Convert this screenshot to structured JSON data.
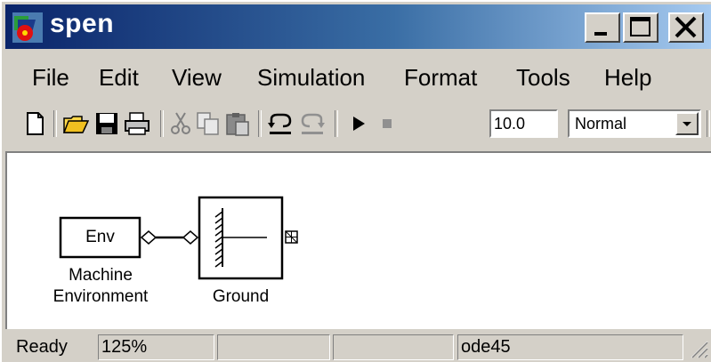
{
  "window": {
    "title": "spen",
    "controls": {
      "minimize": "minimize-icon",
      "maximize": "maximize-icon",
      "close": "close-icon"
    }
  },
  "menubar": {
    "items": [
      "File",
      "Edit",
      "View",
      "Simulation",
      "Format",
      "Tools",
      "Help"
    ]
  },
  "toolbar": {
    "icons": [
      "new-file-icon",
      "open-folder-icon",
      "save-icon",
      "print-icon",
      "cut-icon",
      "copy-icon",
      "paste-icon",
      "undo-icon",
      "redo-icon",
      "start-simulation-icon",
      "stop-simulation-icon"
    ],
    "stop_time": "10.0",
    "sim_mode": "Normal"
  },
  "canvas": {
    "blocks": [
      {
        "name": "Machine Environment",
        "label_line1": "Machine",
        "label_line2": "Environment",
        "inner_text": "Env"
      },
      {
        "name": "Ground",
        "label": "Ground"
      }
    ]
  },
  "statusbar": {
    "status": "Ready",
    "zoom": "125%",
    "cell3": "",
    "cell4": "",
    "solver": "ode45"
  },
  "colors": {
    "titlebar_start": "#0a246a",
    "titlebar_end": "#a6caf0",
    "face": "#d4d0c8"
  }
}
